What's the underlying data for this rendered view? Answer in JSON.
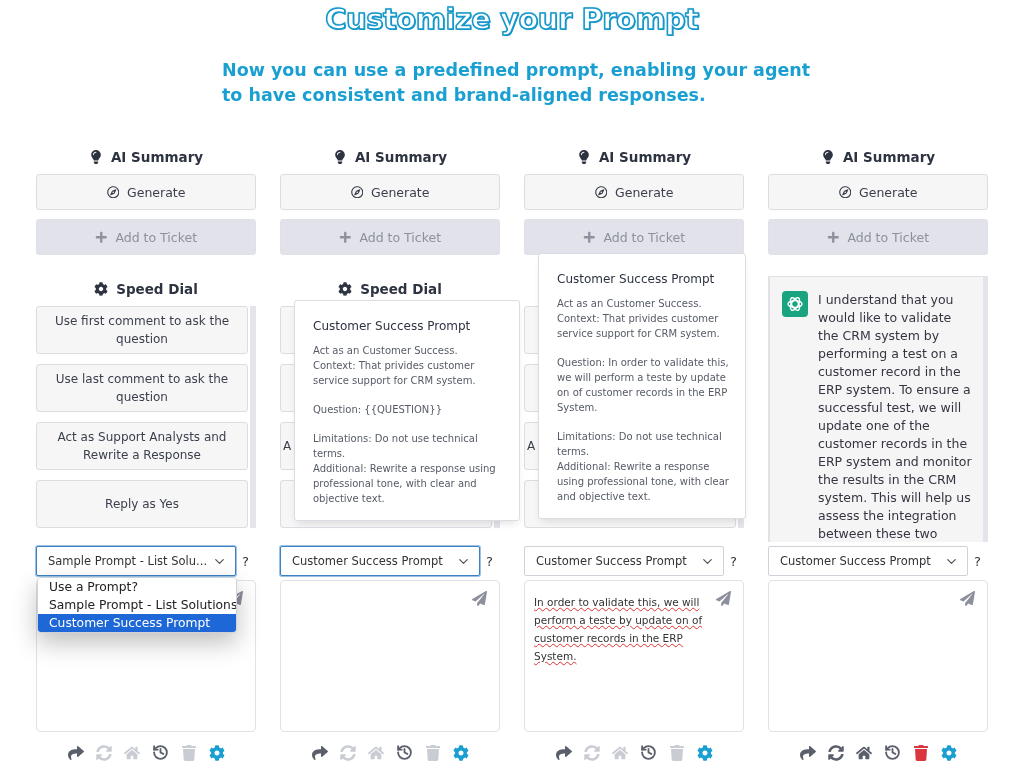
{
  "title": "Customize your Prompt",
  "subtitle": "Now you can use a predefined prompt, enabling your agent to have consistent and brand-aligned responses.",
  "panels": [
    {
      "heading": "AI Summary",
      "generate": "Generate",
      "add_to_ticket": {
        "label": "Add to Ticket",
        "disabled": true
      },
      "content": {
        "kind": "speed_dial",
        "heading": "Speed Dial",
        "items": [
          {
            "kind": "full",
            "label": "Use first comment to ask the question"
          },
          {
            "kind": "full",
            "label": "Use last comment to ask the question"
          },
          {
            "kind": "full",
            "label": "Act as Support Analysts and Rewrite a Response"
          },
          {
            "kind": "full",
            "label": "Reply as Yes"
          }
        ]
      },
      "select": {
        "value": "Sample Prompt - List Solu...",
        "focused": true,
        "options": [
          {
            "label": "Use a Prompt?",
            "selected": false
          },
          {
            "label": "Sample Prompt - List Solutions",
            "selected": false
          },
          {
            "label": "Customer Success Prompt",
            "selected": true
          }
        ]
      },
      "help": "?",
      "toolbar": [
        {
          "kind": "share",
          "disabled": false
        },
        {
          "kind": "refresh",
          "disabled": true
        },
        {
          "kind": "home",
          "disabled": true
        },
        {
          "kind": "history",
          "disabled": false
        },
        {
          "kind": "trash",
          "disabled": true
        },
        {
          "kind": "settings",
          "disabled": false
        }
      ]
    },
    {
      "heading": "AI Summary",
      "generate": "Generate",
      "add_to_ticket": {
        "label": "Add to Ticket",
        "disabled": true
      },
      "content": {
        "kind": "speed_dial",
        "heading": "Speed Dial",
        "items": [
          {
            "kind": "covered"
          },
          {
            "kind": "covered"
          },
          {
            "kind": "partial",
            "label": "A"
          },
          {
            "kind": "covered"
          }
        ]
      },
      "popover": {
        "title": "Customer Success Prompt",
        "paragraphs": [
          [
            "Act as an Customer Success.",
            "Context: That privides customer service support for CRM system."
          ],
          [
            "Question: {{QUESTION}}"
          ],
          [
            "Limitations: Do not use technical terms.",
            "Additional: Rewrite a response using professional tone, with clear and objective text."
          ]
        ]
      },
      "select": {
        "value": "Customer Success Prompt",
        "focused": true
      },
      "help": "?",
      "toolbar": [
        {
          "kind": "share",
          "disabled": false
        },
        {
          "kind": "refresh",
          "disabled": true
        },
        {
          "kind": "home",
          "disabled": true
        },
        {
          "kind": "history",
          "disabled": false
        },
        {
          "kind": "trash",
          "disabled": true
        },
        {
          "kind": "settings",
          "disabled": false
        }
      ]
    },
    {
      "heading": "AI Summary",
      "generate": "Generate",
      "add_to_ticket": {
        "label": "Add to Ticket",
        "disabled": true
      },
      "content": {
        "kind": "speed_dial",
        "items": [
          {
            "kind": "covered"
          },
          {
            "kind": "covered"
          },
          {
            "kind": "partial",
            "label": "A"
          },
          {
            "kind": "covered"
          }
        ]
      },
      "popover": {
        "title": "Customer Success Prompt",
        "paragraphs": [
          [
            "Act as an Customer Success.",
            "Context: That privides customer service support for CRM system."
          ],
          [
            "Question: In order to validate this, we will perform a teste by update on of customer records in the ERP System."
          ],
          [
            "Limitations: Do not use technical terms.",
            "Additional: Rewrite a response using professional tone, with clear and objective text."
          ]
        ]
      },
      "select": {
        "value": "Customer Success Prompt",
        "focused": false
      },
      "help": "?",
      "message": "In order to validate this, we will perform a teste by update on of customer records in the ERP System.",
      "toolbar": [
        {
          "kind": "share",
          "disabled": false
        },
        {
          "kind": "refresh",
          "disabled": true
        },
        {
          "kind": "home",
          "disabled": true
        },
        {
          "kind": "history",
          "disabled": false
        },
        {
          "kind": "trash",
          "disabled": true
        },
        {
          "kind": "settings",
          "disabled": false
        }
      ]
    },
    {
      "heading": "AI Summary",
      "generate": "Generate",
      "add_to_ticket": {
        "label": "Add to Ticket",
        "disabled": true
      },
      "content": {
        "kind": "chat",
        "reply": "I understand that you would like to validate the CRM system by performing a test on a customer record in the ERP system. To ensure a successful test, we will update one of the customer records in the ERP system and monitor the results in the CRM system. This will help us assess the integration between these two"
      },
      "select": {
        "value": "Customer Success Prompt",
        "focused": false
      },
      "help": "?",
      "toolbar": [
        {
          "kind": "share",
          "disabled": false
        },
        {
          "kind": "refresh",
          "disabled": false
        },
        {
          "kind": "home",
          "disabled": false
        },
        {
          "kind": "history",
          "disabled": false
        },
        {
          "kind": "trash",
          "disabled": false
        },
        {
          "kind": "settings",
          "disabled": false
        }
      ]
    }
  ]
}
